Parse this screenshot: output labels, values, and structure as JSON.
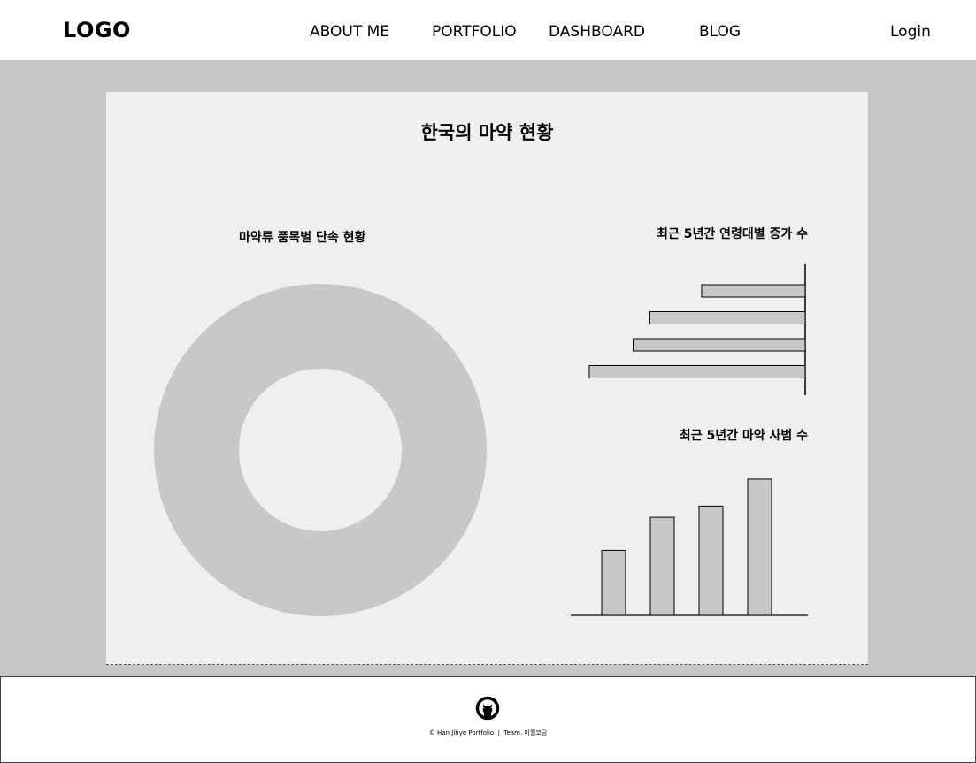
{
  "header": {
    "logo": "LOGO",
    "nav": [
      "ABOUT ME",
      "PORTFOLIO",
      "DASHBOARD",
      "BLOG"
    ],
    "login": "Login"
  },
  "main": {
    "title": "한국의 마약 현황",
    "donut_title": "마약류 품목별 단속 현황",
    "hbar_title": "최근 5년간 연령대별 증가 수",
    "vbar_title": "최근 5년간 마약 사범 수"
  },
  "chart_data": [
    {
      "type": "pie",
      "title": "마약류 품목별 단속 현황",
      "values": [
        1
      ],
      "colors": [
        "#c8c8c8"
      ]
    },
    {
      "type": "bar",
      "orientation": "horizontal",
      "title": "최근 5년간 연령대별 증가 수",
      "values": [
        118,
        177,
        196,
        246
      ],
      "xlim": [
        0,
        250
      ]
    },
    {
      "type": "bar",
      "title": "최근 5년간 마약 사범 수",
      "values": [
        75,
        113,
        126,
        157
      ],
      "ylim": [
        0,
        160
      ]
    }
  ],
  "footer": {
    "icon": "github-icon",
    "text": "© Han Jihye Portfolio  |  Team. 이월코딩"
  }
}
